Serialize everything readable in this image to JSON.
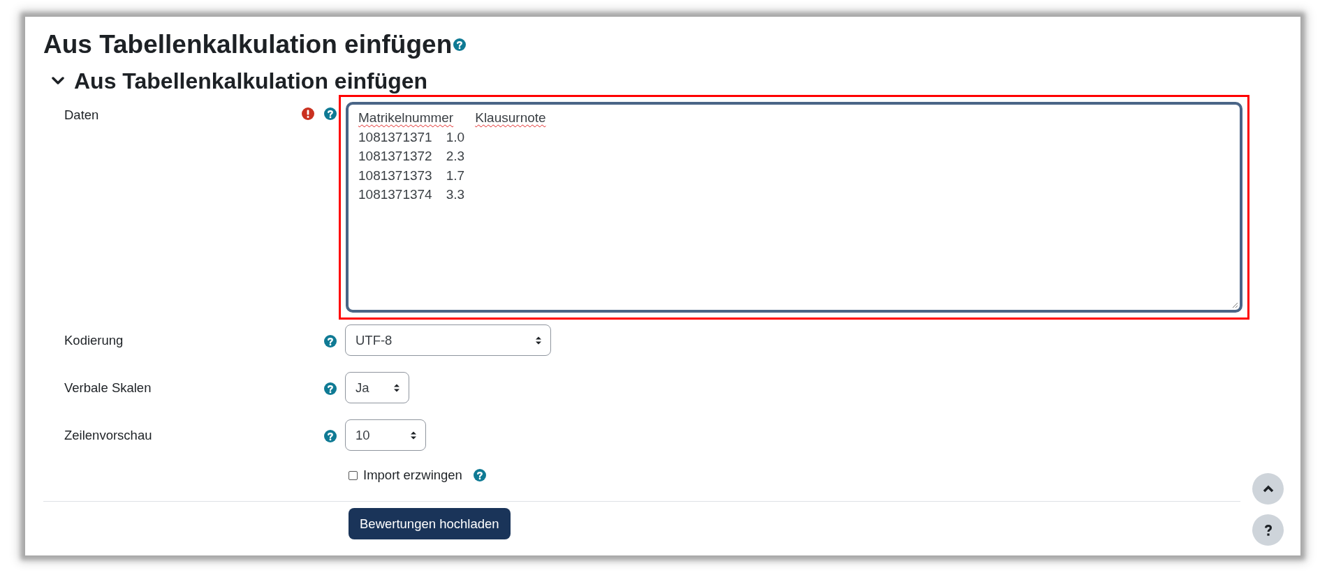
{
  "page": {
    "title": "Aus Tabellenkalkulation einfügen"
  },
  "section": {
    "title": "Aus Tabellenkalkulation einfügen",
    "expanded": true
  },
  "data_field": {
    "label": "Daten",
    "required": true,
    "highlighted": true,
    "rows": [
      {
        "cells": [
          "Matrikelnummer",
          "Klausurnote"
        ],
        "misspelled": true
      },
      {
        "cells": [
          "1081371371",
          "1.0"
        ],
        "misspelled": false
      },
      {
        "cells": [
          "1081371372",
          "2.3"
        ],
        "misspelled": false
      },
      {
        "cells": [
          "1081371373",
          "1.7"
        ],
        "misspelled": false
      },
      {
        "cells": [
          "1081371374",
          "3.3"
        ],
        "misspelled": false
      }
    ]
  },
  "selects": [
    {
      "label": "Kodierung",
      "value": "UTF-8"
    },
    {
      "label": "Verbale Skalen",
      "value": "Ja"
    },
    {
      "label": "Zeilenvorschau",
      "value": "10"
    }
  ],
  "checkbox": {
    "label": "Import erzwingen",
    "checked": false
  },
  "submit_button": "Bewertungen hochladen"
}
